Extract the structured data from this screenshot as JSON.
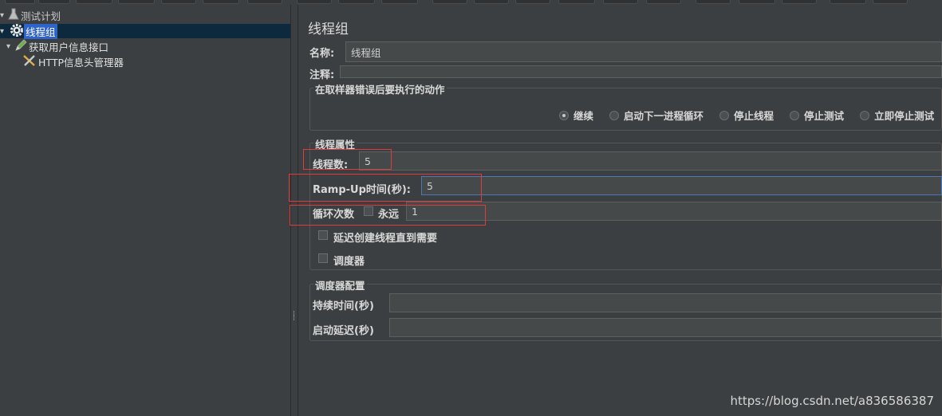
{
  "tree": {
    "items": [
      {
        "label": "测试计划",
        "icon": "flask-icon"
      },
      {
        "label": "线程组",
        "icon": "gear-icon"
      },
      {
        "label": "获取用户信息接口",
        "icon": "pen-icon"
      },
      {
        "label": "HTTP信息头管理器",
        "icon": "tools-icon"
      }
    ]
  },
  "editor": {
    "title": "线程组",
    "name_label": "名称:",
    "name_value": "线程组",
    "comment_label": "注释:",
    "comment_value": "",
    "error_action": {
      "title": "在取样器错误后要执行的动作",
      "options": [
        "继续",
        "启动下一进程循环",
        "停止线程",
        "停止测试",
        "立即停止测试"
      ],
      "selected": "继续"
    },
    "thread_props": {
      "title": "线程属性",
      "threads_label": "线程数:",
      "threads_value": "5",
      "rampup_label": "Ramp-Up时间(秒):",
      "rampup_value": "5",
      "loop_label": "循环次数",
      "forever_label": "永远",
      "loop_value": "1",
      "delay_label": "延迟创建线程直到需要",
      "scheduler_label": "调度器"
    },
    "scheduler_config": {
      "title": "调度器配置",
      "duration_label": "持续时间(秒)",
      "duration_value": "",
      "startup_delay_label": "启动延迟(秒)",
      "startup_delay_value": ""
    }
  },
  "watermark": "https://blog.csdn.net/a836586387",
  "colors": {
    "background": "#3c3f41",
    "selection": "#2f65ca",
    "highlight_box": "#e03a3a",
    "focus_border": "#4c78b8"
  }
}
